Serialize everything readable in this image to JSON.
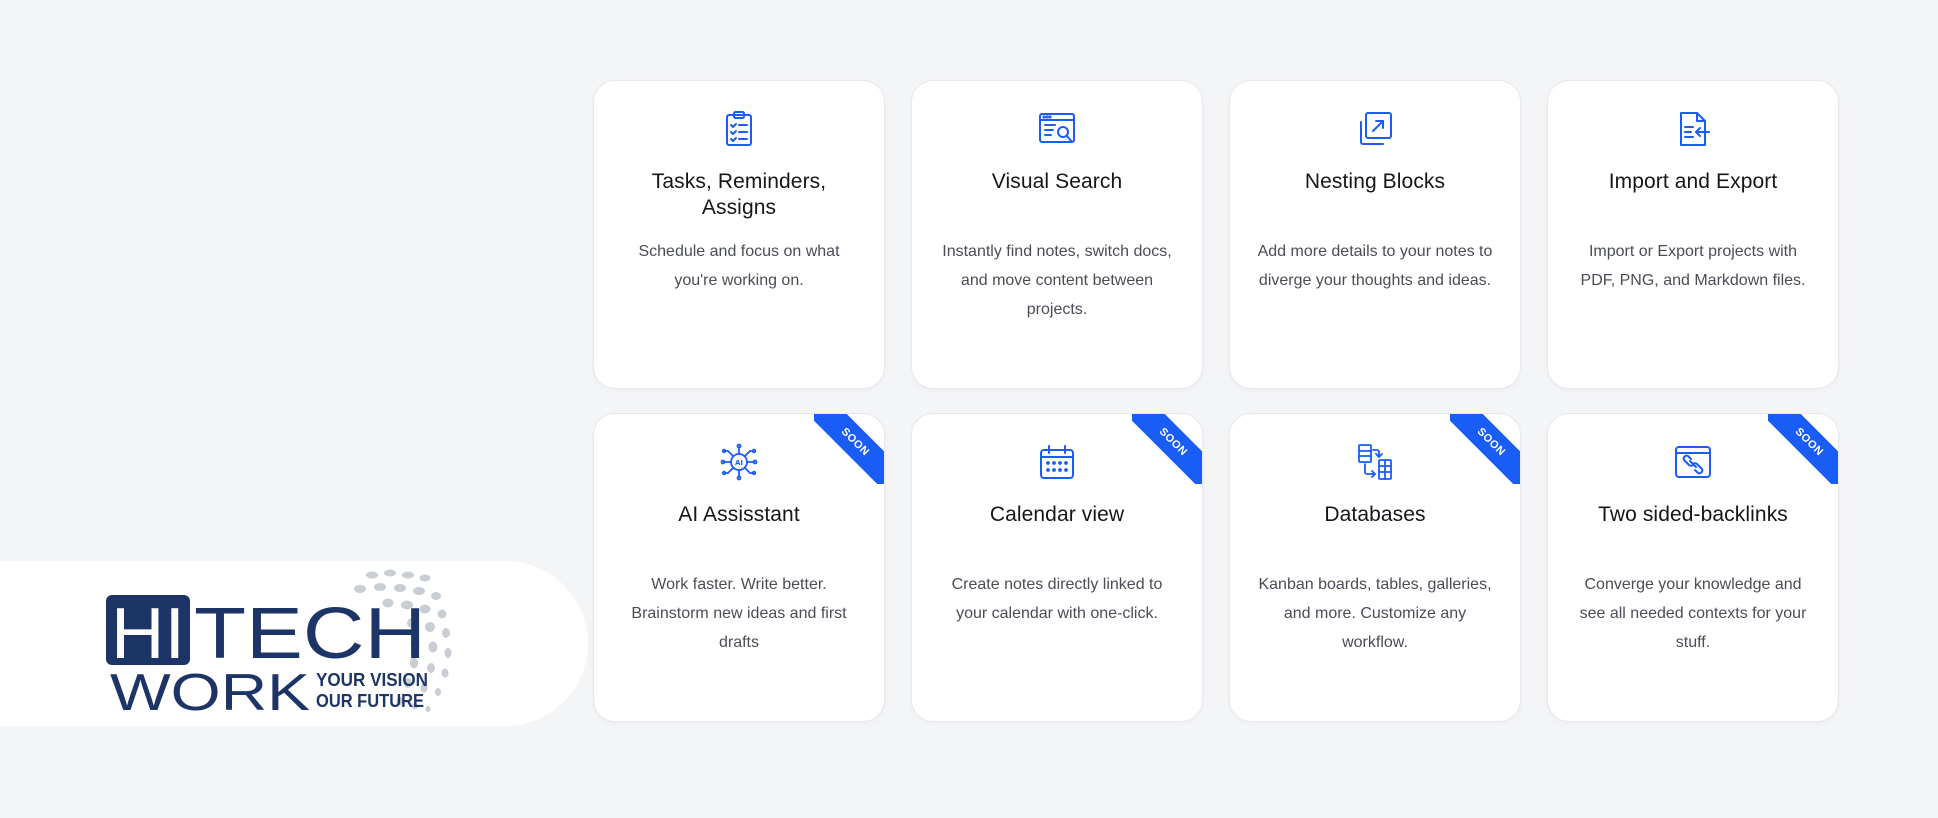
{
  "colors": {
    "accent": "#1a5cf6",
    "logo_navy": "#1d3466",
    "icon_blue": "#1a5cf6"
  },
  "features": [
    {
      "icon": "clipboard-checklist-icon",
      "title": "Tasks, Reminders, Assigns",
      "description": "Schedule and focus on what you're working on.",
      "badge": ""
    },
    {
      "icon": "visual-search-icon",
      "title": "Visual Search",
      "description": "Instantly find notes, switch docs, and move content between projects.",
      "badge": ""
    },
    {
      "icon": "nesting-blocks-icon",
      "title": "Nesting Blocks",
      "description": "Add more details to your notes to diverge your thoughts and ideas.",
      "badge": ""
    },
    {
      "icon": "import-export-icon",
      "title": "Import and Export",
      "description": "Import or Export projects with PDF, PNG, and Markdown files.",
      "badge": ""
    },
    {
      "icon": "ai-chip-icon",
      "title": "AI Assisstant",
      "description": "Work faster. Write better. Brainstorm new ideas and first drafts",
      "badge": "SOON"
    },
    {
      "icon": "calendar-icon",
      "title": "Calendar view",
      "description": "Create notes directly linked to your calendar with one-click.",
      "badge": "SOON"
    },
    {
      "icon": "databases-icon",
      "title": "Databases",
      "description": "Kanban boards, tables, galleries, and more. Customize any workflow.",
      "badge": "SOON"
    },
    {
      "icon": "backlinks-icon",
      "title": "Two sided-backlinks",
      "description": "Converge your knowledge and see all needed contexts for your stuff.",
      "badge": "SOON"
    }
  ],
  "logo": {
    "word_hi": "HI",
    "word_tech": "TECH",
    "word_work": "WORK",
    "tagline_1": "YOUR VISION",
    "tagline_2": "OUR FUTURE"
  }
}
